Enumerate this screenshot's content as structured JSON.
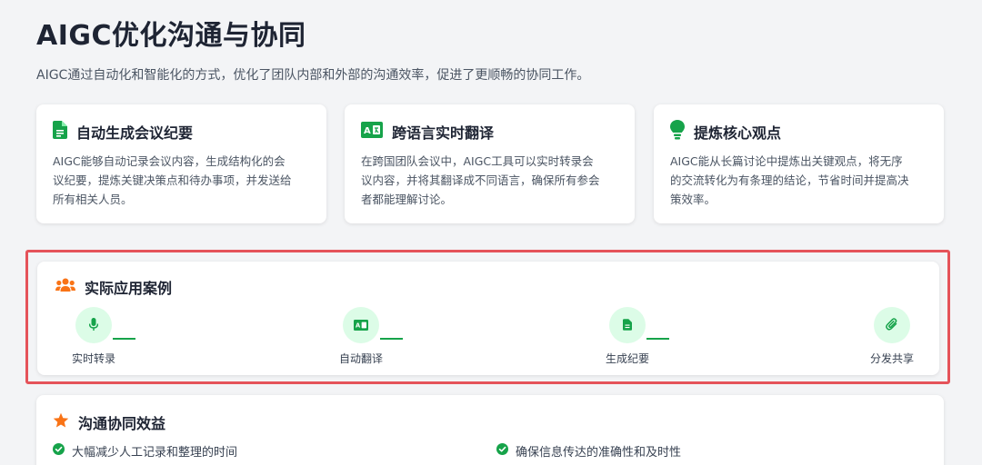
{
  "page": {
    "title": "AIGC优化沟通与协同",
    "subtitle": "AIGC通过自动化和智能化的方式，优化了团队内部和外部的沟通效率，促进了更顺畅的协同工作。"
  },
  "cards": [
    {
      "icon": "document-icon",
      "title": "自动生成会议纪要",
      "lines": [
        "AIGC能够自动记录会议内容，生成结构化的会",
        "议纪要，提炼关键决策点和待办事项，并发送给",
        "所有相关人员。"
      ]
    },
    {
      "icon": "translate-icon",
      "title": "跨语言实时翻译",
      "lines": [
        "在跨国团队会议中，AIGC工具可以实时转录会",
        "议内容，并将其翻译成不同语言，确保所有参会",
        "者都能理解讨论。"
      ]
    },
    {
      "icon": "lightbulb-icon",
      "title": "提炼核心观点",
      "lines": [
        "AIGC能从长篇讨论中提炼出关键观点，将无序",
        "的交流转化为有条理的结论，节省时间并提高决",
        "策效率。"
      ]
    }
  ],
  "cases": {
    "title": "实际应用案例",
    "icon": "users-icon",
    "steps": [
      {
        "label": "实时转录",
        "icon": "microphone-icon"
      },
      {
        "label": "自动翻译",
        "icon": "translate-icon"
      },
      {
        "label": "生成纪要",
        "icon": "document-icon"
      },
      {
        "label": "分发共享",
        "icon": "paperclip-icon"
      }
    ]
  },
  "benefits": {
    "title": "沟通协同效益",
    "icon": "star-icon",
    "items": [
      "大幅减少人工记录和整理的时间",
      "确保信息传达的准确性和及时性"
    ]
  },
  "colors": {
    "accent_green": "#16a34a",
    "light_green": "#dcfce7",
    "highlight_red": "#e5535a",
    "orange": "#f97316"
  }
}
